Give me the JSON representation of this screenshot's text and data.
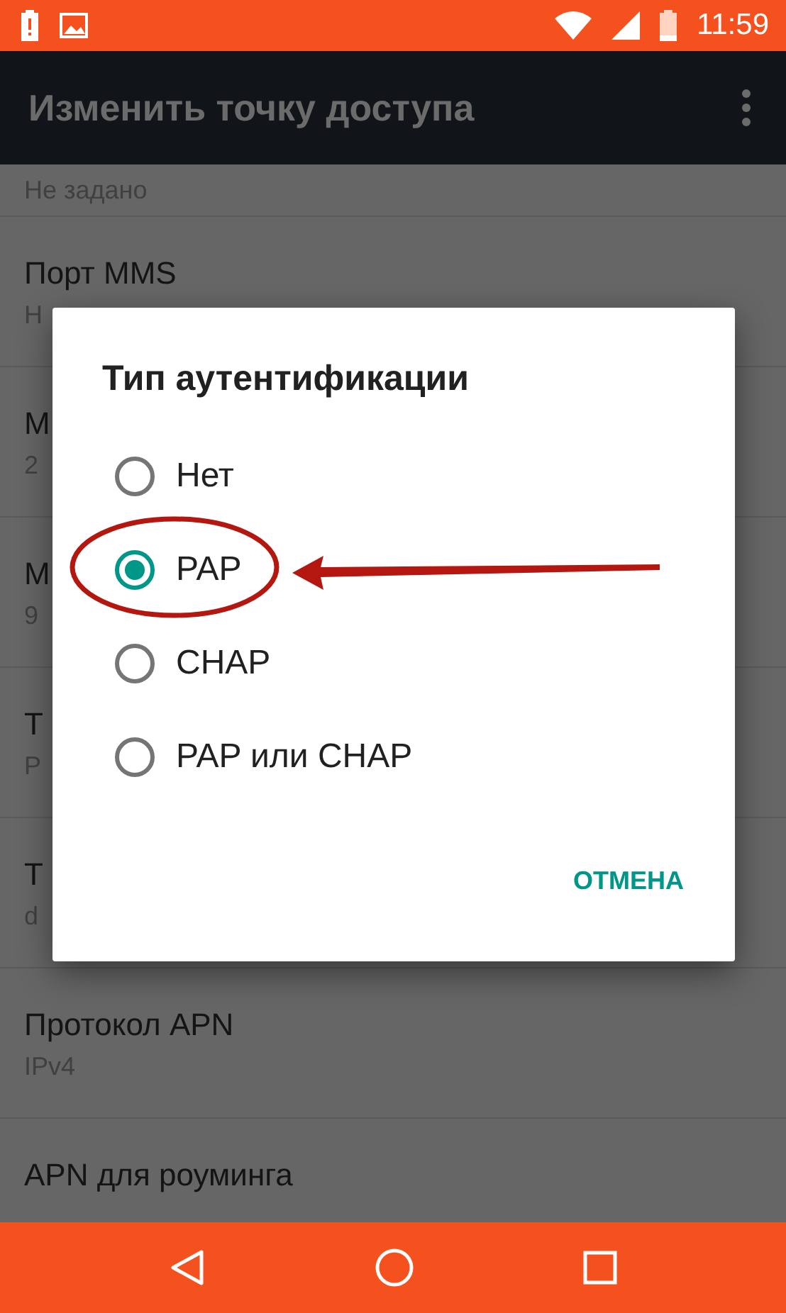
{
  "status_bar": {
    "time": "11:59"
  },
  "app_bar": {
    "title": "Изменить точку доступа"
  },
  "settings": [
    {
      "value": "Не задано"
    },
    {
      "title": "Порт MMS",
      "value": "Н"
    },
    {
      "title": "M",
      "value": "2"
    },
    {
      "title": "M",
      "value": "9"
    },
    {
      "title": "Т",
      "value": "P"
    },
    {
      "title": "Т",
      "value": "d"
    },
    {
      "title": "Протокол APN",
      "value": "IPv4"
    },
    {
      "title": "APN для роуминга"
    }
  ],
  "dialog": {
    "title": "Тип аутентификации",
    "options": [
      {
        "label": "Нет",
        "selected": false
      },
      {
        "label": "PAP",
        "selected": true
      },
      {
        "label": "CHAP",
        "selected": false
      },
      {
        "label": "PAP или CHAP",
        "selected": false
      }
    ],
    "cancel": "ОТМЕНА"
  }
}
